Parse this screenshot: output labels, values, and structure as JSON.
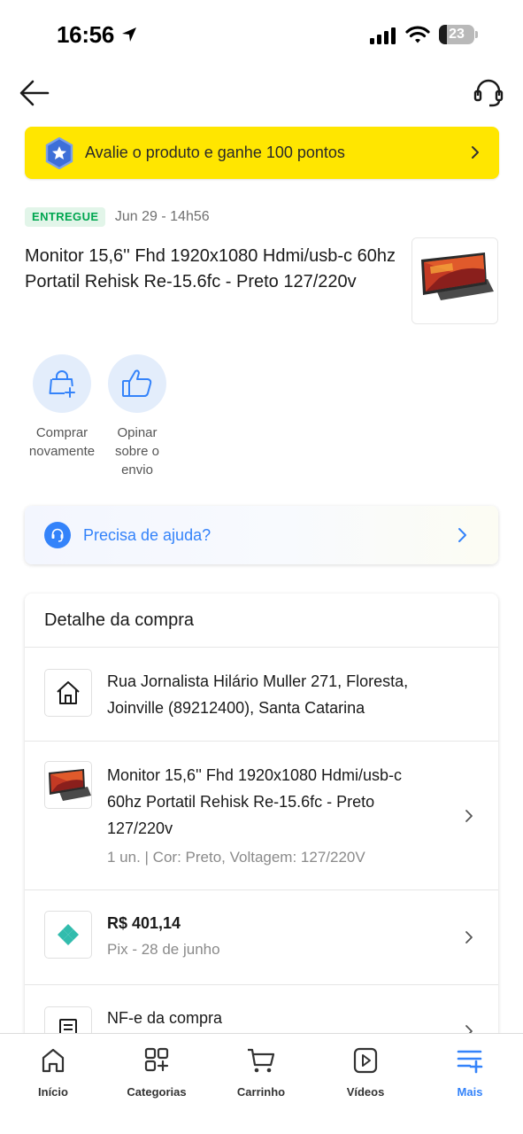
{
  "status_bar": {
    "time": "16:56",
    "battery_level": "23",
    "battery_fraction": 0.23
  },
  "banner": {
    "text": "Avalie o produto e ganhe 100 pontos"
  },
  "order": {
    "status_badge": "ENTREGUE",
    "date": "Jun 29 - 14h56",
    "product_title": "Monitor 15,6'' Fhd 1920x1080 Hdmi/usb-c 60hz Portatil Rehisk Re-15.6fc - Preto 127/220v"
  },
  "actions": [
    {
      "label_line1": "Comprar",
      "label_line2": "novamente"
    },
    {
      "label_line1": "Opinar",
      "label_line2": "sobre o",
      "label_line3": "envio"
    }
  ],
  "help": {
    "text": "Precisa de ajuda?"
  },
  "detail": {
    "header": "Detalhe da compra",
    "address_line1": "Rua Jornalista Hilário Muller 271, Floresta,",
    "address_line2": "Joinville (89212400), Santa Catarina",
    "item_line1": "Monitor 15,6'' Fhd 1920x1080 Hdmi/usb-c",
    "item_line2": "60hz Portatil Rehisk Re-15.6fc - Preto",
    "item_line3": "127/220v",
    "item_meta": "1 un. | Cor: Preto, Voltagem: 127/220V",
    "payment_amount": "R$ 401,14",
    "payment_method": "Pix - 28 de junho",
    "invoice": "NF-e da compra"
  },
  "tabs": [
    {
      "label": "Início",
      "icon": "home-icon"
    },
    {
      "label": "Categorias",
      "icon": "categories-icon"
    },
    {
      "label": "Carrinho",
      "icon": "cart-icon"
    },
    {
      "label": "Vídeos",
      "icon": "video-icon"
    },
    {
      "label": "Mais",
      "icon": "more-icon",
      "active": true
    }
  ],
  "colors": {
    "accent": "#3483fa",
    "banner": "#ffe600",
    "success": "#00a650",
    "action_bg": "#e3edfb"
  }
}
